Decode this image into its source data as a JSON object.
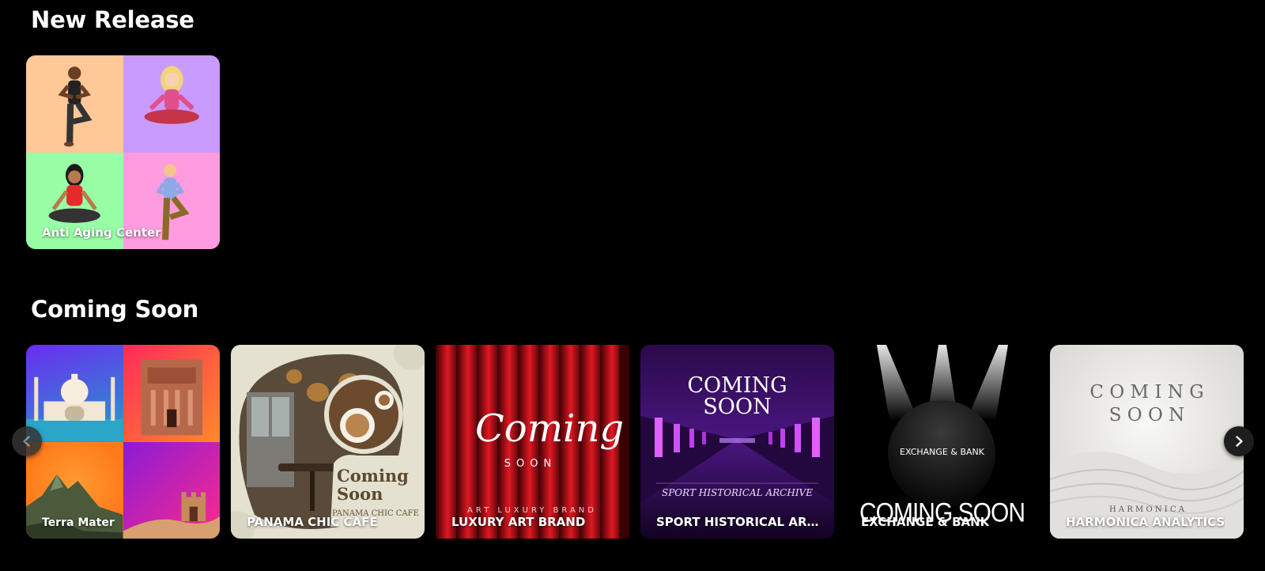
{
  "sections": {
    "new_release": {
      "title": "New Release",
      "cards": [
        {
          "label": "Anti Aging Center"
        }
      ]
    },
    "coming_soon": {
      "title": "Coming Soon",
      "cards": [
        {
          "label": "Terra Mater"
        },
        {
          "label": "PANAMA CHIC CAFE",
          "art_line1": "Coming",
          "art_line2": "Soon",
          "art_caption": "PANAMA CHIC CAFE"
        },
        {
          "label": "LUXURY ART BRAND",
          "art_script": "Coming",
          "art_soon": "SOON",
          "art_caption": "ART LUXURY BRAND"
        },
        {
          "label": "SPORT HISTORICAL ARCHI...",
          "art_line1": "COMING",
          "art_line2": "SOON",
          "art_caption": "SPORT HISTORICAL ARCHIVE"
        },
        {
          "label": "EXCHANGE & BANK",
          "art_circle_text": "EXCHANGE & BANK",
          "art_banner": "COMING SOON"
        },
        {
          "label": "HARMONICA ANALYTICS",
          "art_line1": "C O M I N G",
          "art_line2": "S O O N",
          "art_caption": "H A R M O N I C A"
        }
      ]
    }
  },
  "navigation": {
    "prev_icon": "chevron-left-icon",
    "next_icon": "chevron-right-icon"
  },
  "colors": {
    "background": "#000000",
    "yoga_peach": "#ffc896",
    "yoga_lavender": "#c99bff",
    "yoga_mint": "#98ffa6",
    "yoga_pink": "#ff9ce0"
  }
}
